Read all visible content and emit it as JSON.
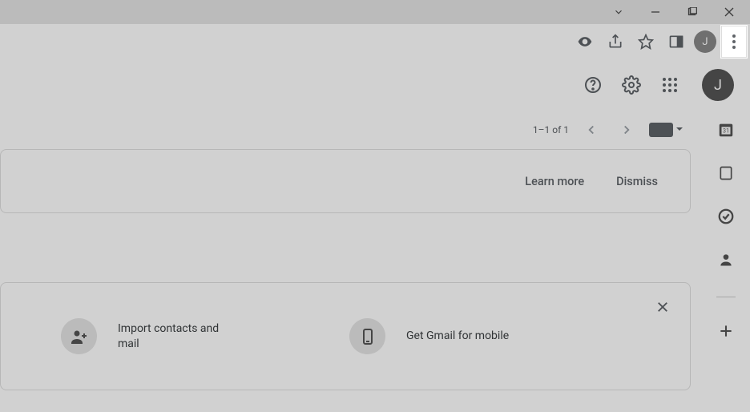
{
  "window": {
    "avatar_initial": "J"
  },
  "header": {
    "avatar_initial": "J"
  },
  "pager": {
    "range": "1–1 of 1"
  },
  "banner": {
    "learn": "Learn more",
    "dismiss": "Dismiss"
  },
  "suggestions": {
    "import": "Import contacts and mail",
    "mobile": "Get Gmail for mobile"
  }
}
